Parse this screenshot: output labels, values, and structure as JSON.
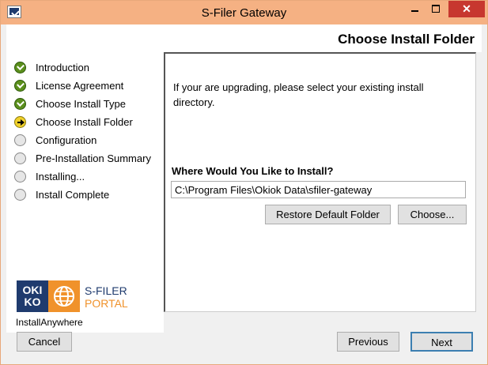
{
  "window": {
    "title": "S-Filer Gateway",
    "close_glyph": "✕"
  },
  "header": {
    "title": "Choose Install Folder"
  },
  "steps": [
    {
      "label": "Introduction",
      "state": "done"
    },
    {
      "label": "License Agreement",
      "state": "done"
    },
    {
      "label": "Choose Install Type",
      "state": "done"
    },
    {
      "label": "Choose Install Folder",
      "state": "current"
    },
    {
      "label": "Configuration",
      "state": "pending"
    },
    {
      "label": "Pre-Installation Summary",
      "state": "pending"
    },
    {
      "label": "Installing...",
      "state": "pending"
    },
    {
      "label": "Install Complete",
      "state": "pending"
    }
  ],
  "logo": {
    "okio_top": "OKI",
    "okio_bottom": "KO",
    "line1": "S-FILER",
    "line2": "PORTAL"
  },
  "installer_label": "InstallAnywhere",
  "main": {
    "description": "If your are upgrading, please select your existing install directory.",
    "where_label": "Where Would You Like to Install?",
    "path_value": "C:\\Program Files\\Okiok Data\\sfiler-gateway",
    "restore_button": "Restore Default Folder",
    "choose_button": "Choose..."
  },
  "footer": {
    "cancel": "Cancel",
    "previous": "Previous",
    "next": "Next"
  },
  "colors": {
    "titlebar": "#f5b183",
    "close": "#c7372f",
    "done": "#5b8f1c",
    "current": "#f0d02a",
    "brand_blue": "#1f3b6e",
    "brand_orange": "#f0922b"
  }
}
